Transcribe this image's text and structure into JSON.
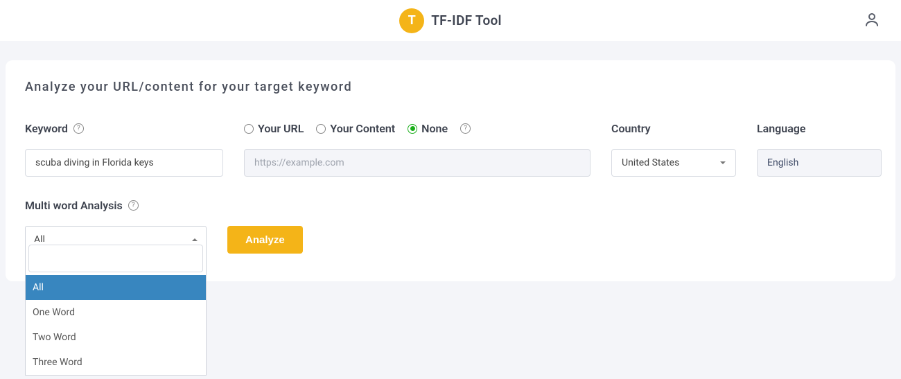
{
  "header": {
    "logo_letter": "T",
    "title": "TF-IDF Tool"
  },
  "card": {
    "heading": "Analyze your URL/content for your target keyword"
  },
  "keyword": {
    "label": "Keyword",
    "value": "scuba diving in Florida keys"
  },
  "source": {
    "options": {
      "your_url": "Your URL",
      "your_content": "Your Content",
      "none": "None"
    },
    "selected": "none",
    "placeholder": "https://example.com"
  },
  "country": {
    "label": "Country",
    "value": "United States"
  },
  "language": {
    "label": "Language",
    "value": "English"
  },
  "multiword": {
    "label": "Multi word Analysis",
    "selected": "All",
    "options": [
      "All",
      "One Word",
      "Two Word",
      "Three Word"
    ]
  },
  "actions": {
    "analyze": "Analyze"
  }
}
